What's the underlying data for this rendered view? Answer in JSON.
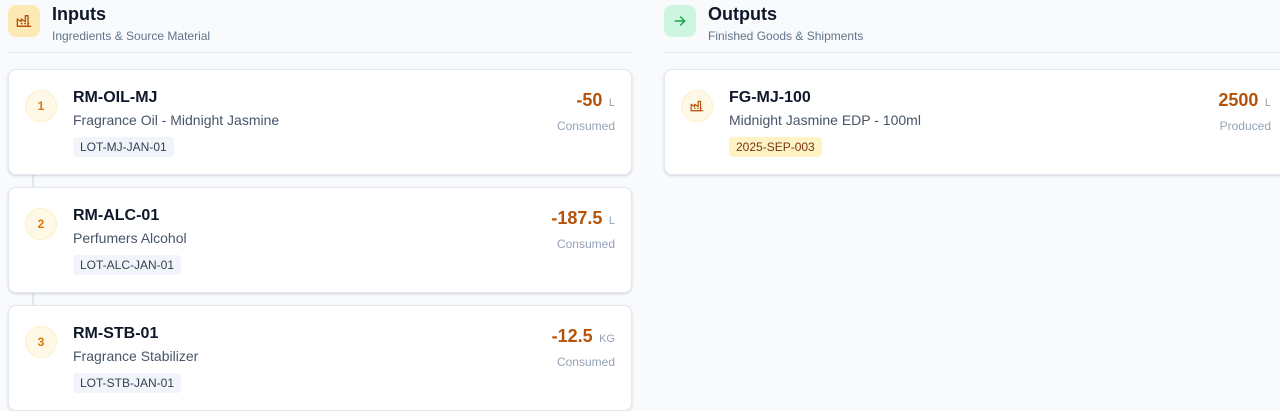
{
  "inputs": {
    "title": "Inputs",
    "subtitle": "Ingredients & Source Material",
    "icon": "factory-icon",
    "items": [
      {
        "index": "1",
        "code": "RM-OIL-MJ",
        "description": "Fragrance Oil - Midnight Jasmine",
        "lot": "LOT-MJ-JAN-01",
        "quantity": "-50",
        "unit": "L",
        "status": "Consumed"
      },
      {
        "index": "2",
        "code": "RM-ALC-01",
        "description": "Perfumers Alcohol",
        "lot": "LOT-ALC-JAN-01",
        "quantity": "-187.5",
        "unit": "L",
        "status": "Consumed"
      },
      {
        "index": "3",
        "code": "RM-STB-01",
        "description": "Fragrance Stabilizer",
        "lot": "LOT-STB-JAN-01",
        "quantity": "-12.5",
        "unit": "KG",
        "status": "Consumed"
      }
    ]
  },
  "outputs": {
    "title": "Outputs",
    "subtitle": "Finished Goods & Shipments",
    "icon": "arrow-right-icon",
    "items": [
      {
        "icon": "factory-icon",
        "code": "FG-MJ-100",
        "description": "Midnight Jasmine EDP - 100ml",
        "lot": "2025-SEP-003",
        "quantity": "2500",
        "unit": "L",
        "status": "Produced"
      }
    ]
  },
  "colors": {
    "accent_amber": "#b45309",
    "inputs_icon_bg": "#fde9b3",
    "outputs_icon_bg": "#cdf5e0",
    "outputs_lot_bg": "#fef3c7"
  }
}
